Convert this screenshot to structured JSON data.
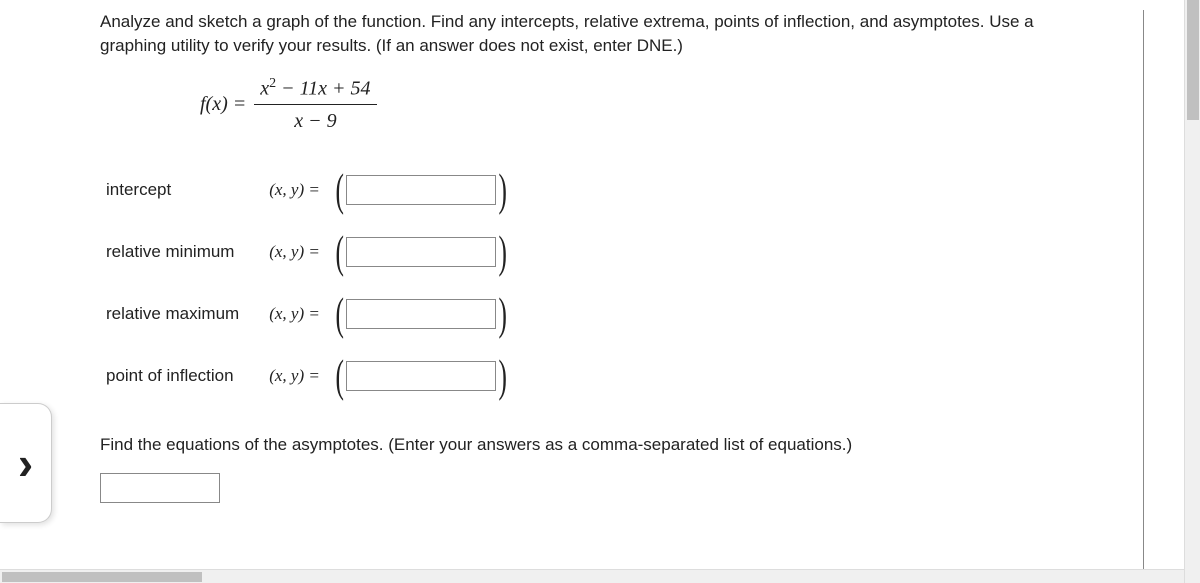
{
  "question": {
    "prompt_line1": "Analyze and sketch a graph of the function. Find any intercepts, relative extrema, points of inflection, and asymptotes. Use a",
    "prompt_line2": "graphing utility to verify your results. (If an answer does not exist, enter DNE.)",
    "func_lhs": "f(x)  = ",
    "frac_top": "x² − 11x + 54",
    "frac_bot": "x − 9"
  },
  "rows": {
    "intercept": "intercept",
    "rel_min": "relative minimum",
    "rel_max": "relative maximum",
    "inflection": "point of inflection"
  },
  "xy_label": "(x, y)  = ",
  "asymptote_prompt": "Find the equations of the asymptotes. (Enter your answers as a comma-separated list of equations.)",
  "inputs": {
    "intercept": "",
    "rel_min": "",
    "rel_max": "",
    "inflection": "",
    "asymptotes": ""
  }
}
